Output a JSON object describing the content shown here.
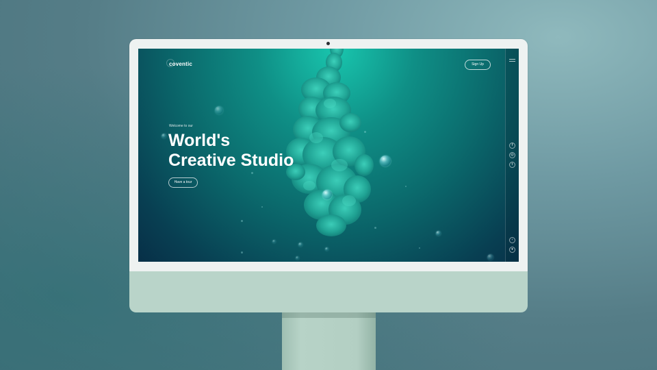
{
  "site": {
    "logo": "coventic",
    "nav": {
      "signup_label": "Sign Up"
    },
    "hero": {
      "welcome": "Welcome to our",
      "headline_line1": "World's",
      "headline_line2": "Creative Studio",
      "cta_label": "Have a tour"
    },
    "sidebar": {
      "socials": [
        {
          "icon": "facebook-icon",
          "glyph": "f"
        },
        {
          "icon": "instagram-icon",
          "glyph": "◎"
        },
        {
          "icon": "twitter-icon",
          "glyph": "t"
        }
      ],
      "controls": [
        {
          "icon": "arrow-left-icon",
          "glyph": "‹"
        },
        {
          "icon": "arrow-down-icon",
          "glyph": "▾"
        }
      ]
    },
    "colors": {
      "accent": "#19c6ae",
      "deep": "#072f47",
      "ink": "#2ec2ad"
    }
  },
  "device": {
    "type": "iMac",
    "bezel_color": "#eef2f1",
    "chin_color": "#b9d4c9"
  }
}
